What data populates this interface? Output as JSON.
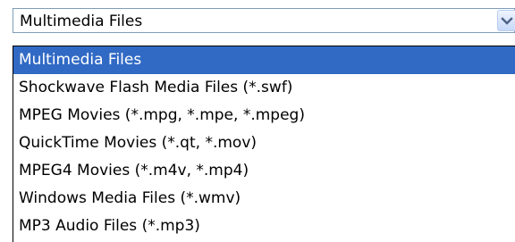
{
  "combo": {
    "selected_value": "Multimedia Files",
    "button_icon": "chevron-down-icon"
  },
  "dropdown": {
    "options": [
      {
        "label": "Multimedia Files",
        "selected": true
      },
      {
        "label": "Shockwave Flash Media Files (*.swf)",
        "selected": false
      },
      {
        "label": "MPEG Movies (*.mpg, *.mpe, *.mpeg)",
        "selected": false
      },
      {
        "label": "QuickTime Movies (*.qt, *.mov)",
        "selected": false
      },
      {
        "label": "MPEG4 Movies (*.m4v, *.mp4)",
        "selected": false
      },
      {
        "label": "Windows Media Files (*.wmv)",
        "selected": false
      },
      {
        "label": "MP3 Audio Files (*.mp3)",
        "selected": false
      }
    ]
  },
  "colors": {
    "selection_background": "#316ac5",
    "selection_text": "#ffffff",
    "combo_border": "#7f9db9"
  }
}
